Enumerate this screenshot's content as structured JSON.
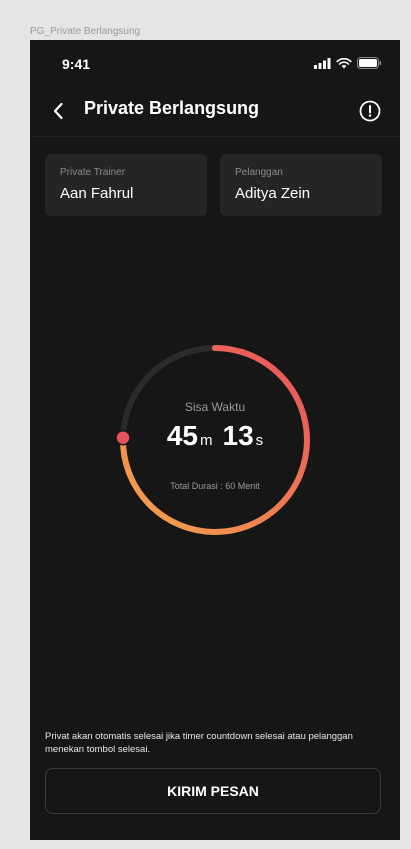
{
  "frame_label": "PG_Private Berlangsung",
  "status_bar": {
    "time": "9:41"
  },
  "header": {
    "title": "Private Berlangsung",
    "back_icon": "chevron-left-icon",
    "info_icon": "alert-circle-icon"
  },
  "participants": {
    "trainer": {
      "label": "Private Trainer",
      "name": "Aan Fahrul"
    },
    "customer": {
      "label": "Pelanggan",
      "name": "Aditya Zein"
    }
  },
  "timer": {
    "label": "Sisa Waktu",
    "minutes": "45",
    "minutes_unit": "m",
    "seconds": "13",
    "seconds_unit": "s",
    "total_duration": "Total Durasi : 60 Menit",
    "progress_remaining_fraction": 0.754,
    "gradient_start_color": "#f5a54a",
    "gradient_end_color": "#e8505b",
    "track_color": "#2b2b2b"
  },
  "note": "Privat akan otomatis selesai jika timer countdown selesai atau pelanggan menekan tombol selesai.",
  "send_button": {
    "label": "KIRIM PESAN"
  }
}
